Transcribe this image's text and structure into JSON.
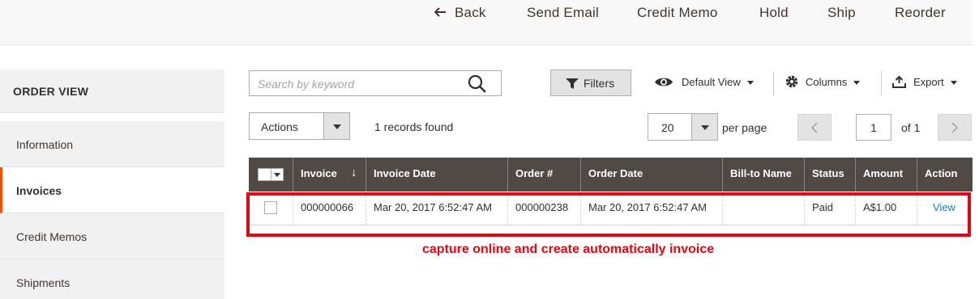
{
  "topbar": {
    "back_label": "Back",
    "send_email_label": "Send Email",
    "credit_memo_label": "Credit Memo",
    "hold_label": "Hold",
    "ship_label": "Ship",
    "reorder_label": "Reorder"
  },
  "sidebar": {
    "title": "ORDER VIEW",
    "items": [
      {
        "label": "Information"
      },
      {
        "label": "Invoices",
        "active": true
      },
      {
        "label": "Credit Memos"
      },
      {
        "label": "Shipments"
      }
    ]
  },
  "toolbar": {
    "search_placeholder": "Search by keyword",
    "filters_label": "Filters",
    "default_view_label": "Default View",
    "columns_label": "Columns",
    "export_label": "Export"
  },
  "grid_controls": {
    "actions_label": "Actions",
    "records_found": "1 records found",
    "per_page_value": "20",
    "per_page_label": "per page",
    "current_page": "1",
    "page_of": "of 1"
  },
  "grid": {
    "columns": [
      "Invoice",
      "Invoice Date",
      "Order #",
      "Order Date",
      "Bill-to Name",
      "Status",
      "Amount",
      "Action"
    ],
    "rows": [
      {
        "invoice": "000000066",
        "invoice_date": "Mar 20, 2017 6:52:47 AM",
        "order": "000000238",
        "order_date": "Mar 20, 2017 6:52:47 AM",
        "bill_to_name": "",
        "status": "Paid",
        "amount": "A$1.00",
        "action": "View"
      }
    ]
  },
  "annotation": {
    "text": "capture online and create automatically invoice",
    "color": "#e30613"
  },
  "colors": {
    "header_bg": "#514943",
    "link": "#1979c3",
    "active_accent": "#eb5202"
  }
}
